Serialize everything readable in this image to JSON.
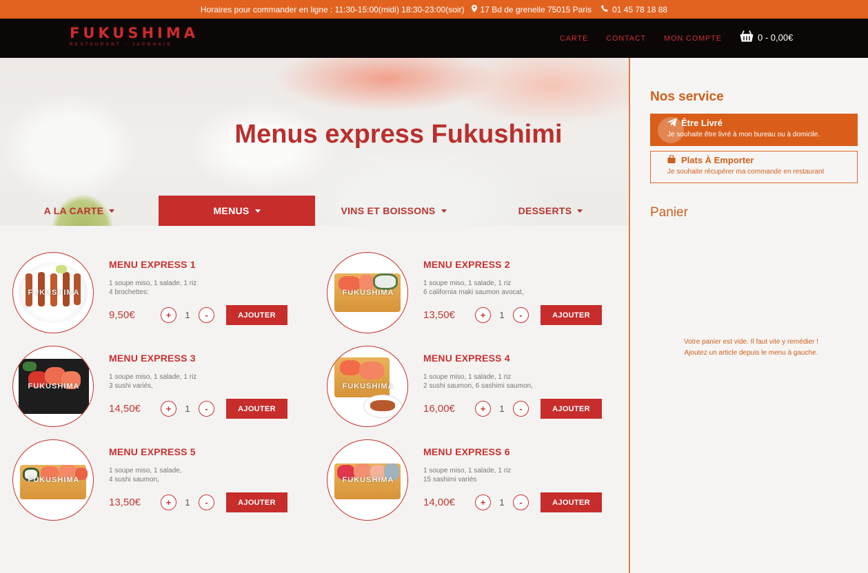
{
  "topbar": {
    "hours": "Horaires pour commander en ligne : 11:30-15:00(midi) 18:30-23:00(soir)",
    "address": "17 Bd de grenelle 75015 Paris",
    "phone": "01 45 78 18 88"
  },
  "header": {
    "logo": "FUKUSHIMA",
    "logo_tagline": "RESTAURANT - JAPONAIS",
    "nav": [
      "CARTE",
      "CONTACT",
      "MON COMPTE"
    ],
    "cart": "0 - 0,00€"
  },
  "hero": {
    "title": "Menus express Fukushimi"
  },
  "tabs": [
    {
      "label": "A LA CARTE",
      "active": false
    },
    {
      "label": "MENUS",
      "active": true
    },
    {
      "label": "VINS ET BOISSONS",
      "active": false
    },
    {
      "label": "DESSERTS",
      "active": false
    }
  ],
  "watermark": "FUKUSHIMA",
  "products": [
    {
      "name": "MENU EXPRESS 1",
      "desc1": "1 soupe miso, 1 salade, 1 riz",
      "desc2": "4 brochettes:",
      "price": "9,50€",
      "qty": "1",
      "plus": "+",
      "minus": "-",
      "add": "AJOUTER"
    },
    {
      "name": "MENU EXPRESS 2",
      "desc1": "1 soupe miso, 1 salade, 1 riz",
      "desc2": "6 california maki saumon avocat,",
      "price": "13,50€",
      "qty": "1",
      "plus": "+",
      "minus": "-",
      "add": "AJOUTER"
    },
    {
      "name": "MENU EXPRESS 3",
      "desc1": "1 soupe miso, 1 salade, 1 riz",
      "desc2": "3 sushi variés,",
      "price": "14,50€",
      "qty": "1",
      "plus": "+",
      "minus": "-",
      "add": "AJOUTER"
    },
    {
      "name": "MENU EXPRESS 4",
      "desc1": "1 soupe miso, 1 salade, 1 riz",
      "desc2": "2 sushi saumon, 6 sashimi saumon,",
      "price": "16,00€",
      "qty": "1",
      "plus": "+",
      "minus": "-",
      "add": "AJOUTER"
    },
    {
      "name": "MENU EXPRESS 5",
      "desc1": "1 soupe miso, 1 salade,",
      "desc2": "4 sushi saumon,",
      "price": "13,50€",
      "qty": "1",
      "plus": "+",
      "minus": "-",
      "add": "AJOUTER"
    },
    {
      "name": "MENU EXPRESS 6",
      "desc1": "1 soupe miso, 1 salade, 1 riz",
      "desc2": "15 sashimi variés",
      "price": "14,00€",
      "qty": "1",
      "plus": "+",
      "minus": "-",
      "add": "AJOUTER"
    }
  ],
  "sidebar": {
    "services_title": "Nos service",
    "delivery_title": "Être Livré",
    "delivery_desc": "Je souhaite être livré à mon bureau ou à domicile.",
    "takeaway_title": "Plats À Emporter",
    "takeaway_desc": "Je souhaite récupérer ma commande en restaurant",
    "cart_title": "Panier",
    "cart_empty_1": "Votre panier est vide. Il faut vite y remédier !",
    "cart_empty_2": "Ajoutez un article depuis le menu à gauche."
  },
  "icons": {
    "address": "map-marker-icon",
    "phone": "phone-icon",
    "cart": "basket-icon",
    "delivery": "paper-plane-icon",
    "takeaway": "shopping-bag-icon"
  },
  "colors": {
    "topbar": "#e2621f",
    "header": "#0c0707",
    "accent_red": "#c62d2b",
    "accent_orange": "#d85e1a"
  }
}
